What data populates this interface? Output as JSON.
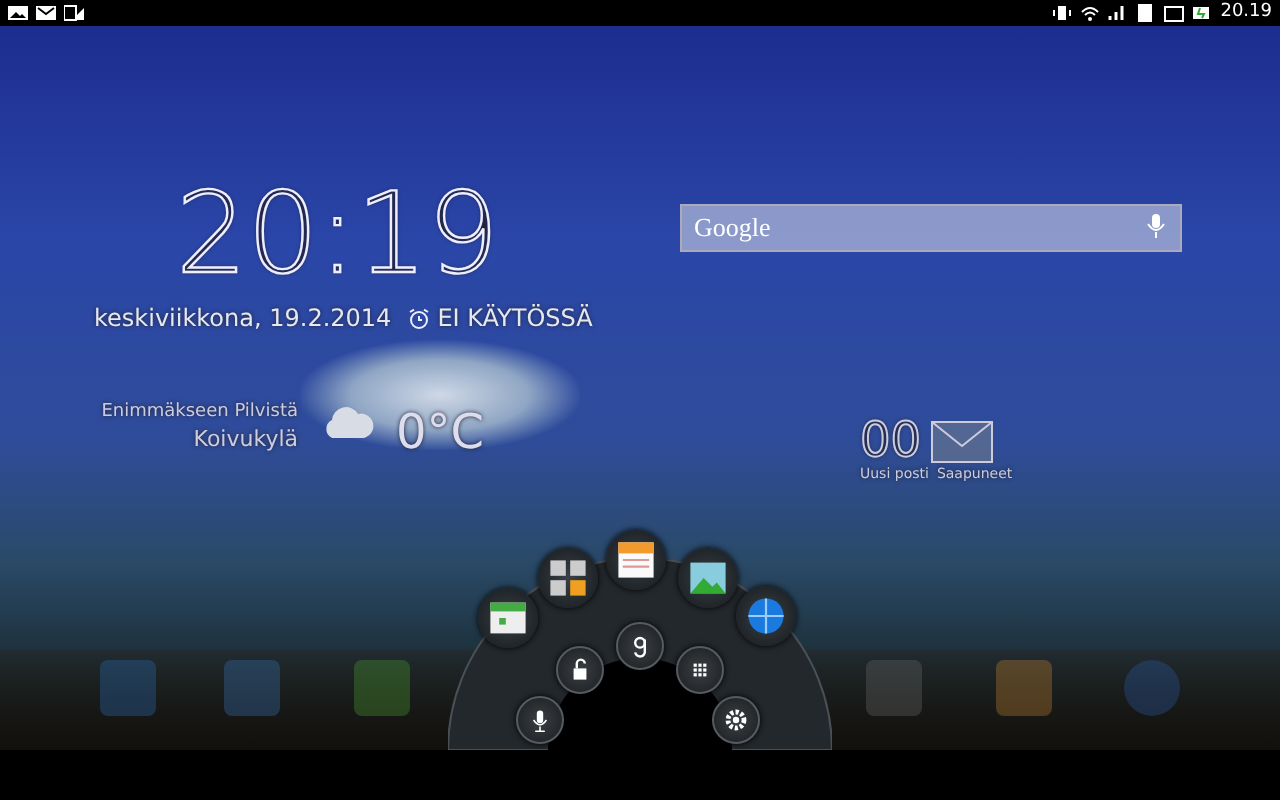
{
  "status_bar": {
    "time": "20.19"
  },
  "clock_widget": {
    "time": "20:19",
    "date": "keskiviikkona, 19.2.2014",
    "alarm": "EI KÄYTÖSSÄ"
  },
  "weather_widget": {
    "condition": "Enimmäkseen Pilvistä",
    "location": "Koivukylä",
    "temperature": "0°C"
  },
  "search": {
    "placeholder": "Google"
  },
  "mail_widget": {
    "count": "00",
    "labels": [
      "Uusi posti",
      "Saapuneet"
    ]
  }
}
